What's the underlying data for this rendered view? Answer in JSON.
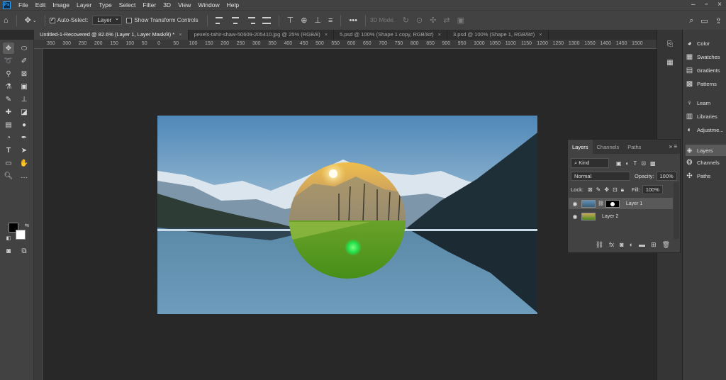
{
  "menu": [
    "File",
    "Edit",
    "Image",
    "Layer",
    "Type",
    "Select",
    "Filter",
    "3D",
    "View",
    "Window",
    "Help"
  ],
  "options": {
    "auto_select_label": "Auto-Select:",
    "auto_select_value": "Layer",
    "transform_label": "Show Transform Controls",
    "mode_3d": "3D Mode:"
  },
  "tabs": [
    {
      "title": "Untitled-1-Recovered @ 82.6% (Layer 1, Layer Mask/8) *",
      "close": "×"
    },
    {
      "title": "pexels-tahir-shaw-50609-205410.jpg @ 25% (RGB/8)",
      "close": "×"
    },
    {
      "title": "5.psd @ 100% (Shape 1 copy, RGB/8#)",
      "close": "×"
    },
    {
      "title": "3.psd @ 100% (Shape 1, RGB/8#)",
      "close": "×"
    }
  ],
  "ruler_labels": [
    "350",
    "300",
    "250",
    "200",
    "150",
    "100",
    "50",
    "0",
    "50",
    "100",
    "150",
    "200",
    "250",
    "300",
    "350",
    "400",
    "450",
    "500",
    "550",
    "600",
    "650",
    "700",
    "750",
    "800",
    "850",
    "900",
    "950",
    "1000",
    "1050",
    "1100",
    "1150",
    "1200",
    "1250",
    "1300",
    "1350",
    "1400",
    "1450",
    "1500"
  ],
  "panels": [
    {
      "label": "Color",
      "icon": "color-icon"
    },
    {
      "label": "Swatches",
      "icon": "swatches-icon"
    },
    {
      "label": "Gradients",
      "icon": "gradients-icon"
    },
    {
      "label": "Patterns",
      "icon": "patterns-icon"
    },
    {
      "label": "Learn",
      "icon": "learn-icon"
    },
    {
      "label": "Libraries",
      "icon": "libraries-icon"
    },
    {
      "label": "Adjustme...",
      "icon": "adjustments-icon"
    },
    {
      "label": "Layers",
      "icon": "layers-icon"
    },
    {
      "label": "Channels",
      "icon": "channels-icon"
    },
    {
      "label": "Paths",
      "icon": "paths-icon"
    }
  ],
  "layers_panel": {
    "tabs": [
      "Layers",
      "Channels",
      "Paths"
    ],
    "kind_label": "Kind",
    "blend_mode": "Normal",
    "opacity_label": "Opacity:",
    "opacity_value": "100%",
    "lock_label": "Lock:",
    "fill_label": "Fill:",
    "fill_value": "100%",
    "layers": [
      {
        "name": "Layer 1",
        "selected": true
      },
      {
        "name": "Layer 2",
        "selected": false
      }
    ]
  }
}
